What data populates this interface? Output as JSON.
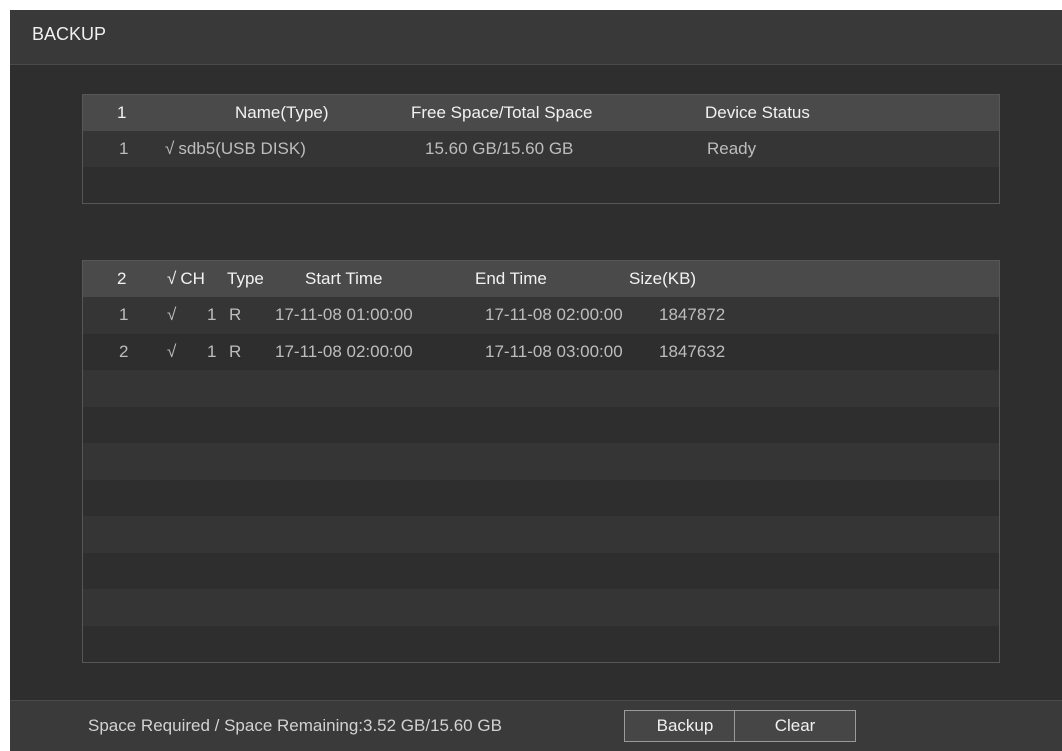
{
  "window": {
    "title": "BACKUP"
  },
  "devices": {
    "headers": {
      "index": "1",
      "name": "Name(Type)",
      "space": "Free Space/Total Space",
      "status": "Device Status"
    },
    "rows": [
      {
        "index": "1",
        "checked": true,
        "name": "sdb5(USB DISK)",
        "space": "15.60 GB/15.60 GB",
        "status": "Ready"
      }
    ]
  },
  "files": {
    "headers": {
      "index": "2",
      "ch": "CH",
      "type": "Type",
      "start": "Start Time",
      "end": "End Time",
      "size": "Size(KB)"
    },
    "header_checked": true,
    "rows": [
      {
        "index": "1",
        "checked": true,
        "ch": "1",
        "type": "R",
        "start": "17-11-08 01:00:00",
        "end": "17-11-08 02:00:00",
        "size": "1847872"
      },
      {
        "index": "2",
        "checked": true,
        "ch": "1",
        "type": "R",
        "start": "17-11-08 02:00:00",
        "end": "17-11-08 03:00:00",
        "size": "1847632"
      }
    ]
  },
  "footer": {
    "space_info": "Space Required / Space Remaining:3.52 GB/15.60 GB",
    "backup_label": "Backup",
    "clear_label": "Clear"
  }
}
